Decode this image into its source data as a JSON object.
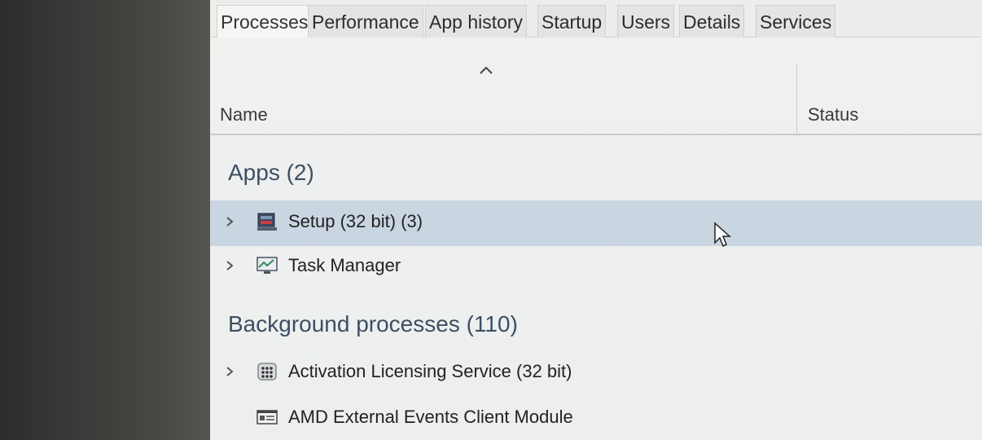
{
  "tabs": [
    {
      "label": "Processes",
      "active": true
    },
    {
      "label": "Performance",
      "active": false
    },
    {
      "label": "App history",
      "active": false
    },
    {
      "label": "Startup",
      "active": false
    },
    {
      "label": "Users",
      "active": false
    },
    {
      "label": "Details",
      "active": false
    },
    {
      "label": "Services",
      "active": false
    }
  ],
  "columns": {
    "name": "Name",
    "status": "Status",
    "sort_icon": "caret-up-icon"
  },
  "groups": {
    "apps": {
      "title": "Apps (2)",
      "rows": [
        {
          "label": "Setup (32 bit) (3)",
          "icon": "setup-icon",
          "expandable": true,
          "selected": true
        },
        {
          "label": "Task Manager",
          "icon": "task-manager-icon",
          "expandable": true,
          "selected": false
        }
      ]
    },
    "background": {
      "title": "Background processes (110)",
      "rows": [
        {
          "label": "Activation Licensing Service (32 bit)",
          "icon": "service-icon",
          "expandable": true,
          "selected": false
        },
        {
          "label": "AMD External Events Client Module",
          "icon": "window-app-icon",
          "expandable": false,
          "selected": false
        }
      ]
    }
  },
  "colors": {
    "selected_row": "#c9d5e1",
    "group_title": "#3d4f63"
  }
}
